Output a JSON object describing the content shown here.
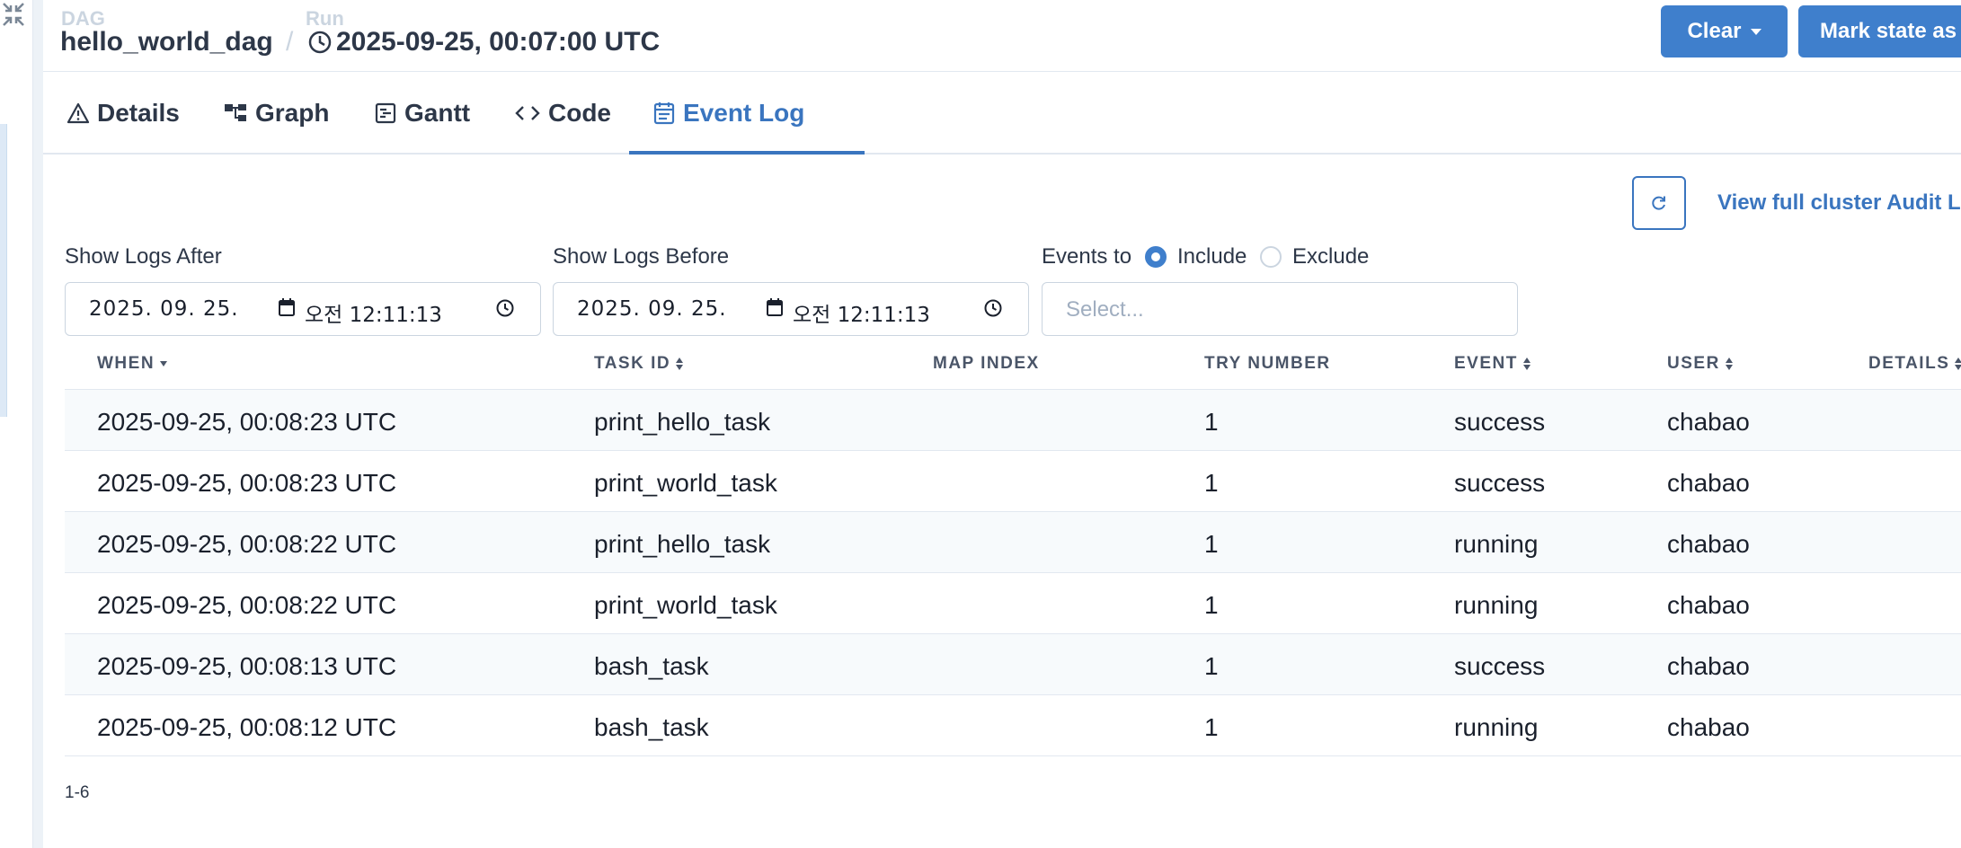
{
  "header": {
    "dag_label": "DAG",
    "dag_name": "hello_world_dag",
    "separator": "/",
    "run_label": "Run",
    "run_value": "2025-09-25, 00:07:00 UTC",
    "clear_button": "Clear",
    "mark_state_button": "Mark state as"
  },
  "tabs": [
    {
      "label": "Details",
      "icon": "warning-icon"
    },
    {
      "label": "Graph",
      "icon": "graph-icon"
    },
    {
      "label": "Gantt",
      "icon": "gantt-icon"
    },
    {
      "label": "Code",
      "icon": "code-icon"
    },
    {
      "label": "Event Log",
      "icon": "calendar-list-icon",
      "active": true
    }
  ],
  "toolbar": {
    "refresh_icon": "refresh-icon",
    "audit_link": "View full cluster Audit Lo"
  },
  "filters": {
    "after_label": "Show Logs After",
    "after_date": "2025. 09. 25.",
    "after_time": "오전 12:11:13",
    "before_label": "Show Logs Before",
    "before_date": "2025. 09. 25.",
    "before_time": "오전 12:11:13",
    "events_label": "Events to",
    "include_label": "Include",
    "exclude_label": "Exclude",
    "selected_mode": "Include",
    "select_placeholder": "Select..."
  },
  "table": {
    "columns": {
      "when": "WHEN",
      "task_id": "TASK ID",
      "map_index": "MAP INDEX",
      "try_number": "TRY NUMBER",
      "event": "EVENT",
      "user": "USER",
      "details": "DETAILS"
    },
    "rows": [
      {
        "when": "2025-09-25, 00:08:23 UTC",
        "task_id": "print_hello_task",
        "map_index": "",
        "try_number": "1",
        "event": "success",
        "user": "chabao",
        "details": ""
      },
      {
        "when": "2025-09-25, 00:08:23 UTC",
        "task_id": "print_world_task",
        "map_index": "",
        "try_number": "1",
        "event": "success",
        "user": "chabao",
        "details": ""
      },
      {
        "when": "2025-09-25, 00:08:22 UTC",
        "task_id": "print_hello_task",
        "map_index": "",
        "try_number": "1",
        "event": "running",
        "user": "chabao",
        "details": ""
      },
      {
        "when": "2025-09-25, 00:08:22 UTC",
        "task_id": "print_world_task",
        "map_index": "",
        "try_number": "1",
        "event": "running",
        "user": "chabao",
        "details": ""
      },
      {
        "when": "2025-09-25, 00:08:13 UTC",
        "task_id": "bash_task",
        "map_index": "",
        "try_number": "1",
        "event": "success",
        "user": "chabao",
        "details": ""
      },
      {
        "when": "2025-09-25, 00:08:12 UTC",
        "task_id": "bash_task",
        "map_index": "",
        "try_number": "1",
        "event": "running",
        "user": "chabao",
        "details": ""
      }
    ]
  },
  "pagination": {
    "range": "1-6"
  },
  "colors": {
    "primary": "#3f7fcc",
    "link": "#3a75bf",
    "text": "#1a202c",
    "muted": "#cbd5e0"
  }
}
